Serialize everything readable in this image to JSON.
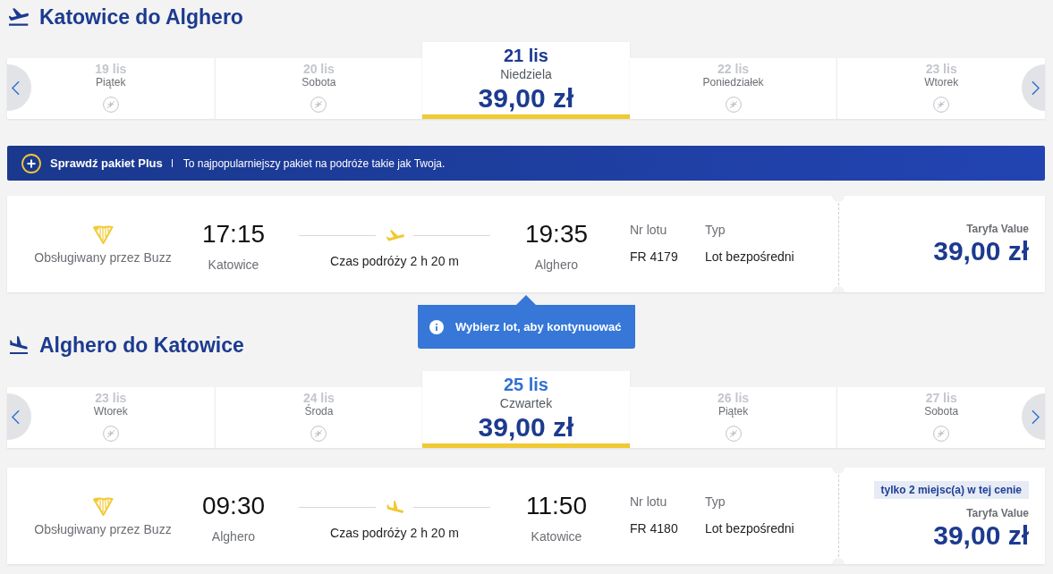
{
  "journeys": [
    {
      "kind": "departure",
      "title": "Katowice do Alghero",
      "dates": [
        {
          "date": "19 lis",
          "day": "Piątek",
          "selected": false,
          "hovered": false
        },
        {
          "date": "20 lis",
          "day": "Sobota",
          "selected": false,
          "hovered": false
        },
        {
          "date": "21 lis",
          "day": "Niedziela",
          "price": "39,00 zł",
          "selected": true,
          "hovered": false
        },
        {
          "date": "22 lis",
          "day": "Poniedziałek",
          "selected": false,
          "hovered": false
        },
        {
          "date": "23 lis",
          "day": "Wtorek",
          "selected": false,
          "hovered": false
        }
      ],
      "promo": {
        "title": "Sprawdź pakiet Plus",
        "text": "To najpopularniejszy pakiet na podróże takie jak Twoja."
      },
      "flight": {
        "operator": "Obsługiwany przez Buzz",
        "departure_time": "17:15",
        "departure_city": "Katowice",
        "duration": "Czas podróży 2 h 20 m",
        "arrival_time": "19:35",
        "arrival_city": "Alghero",
        "flight_number_label": "Nr lotu",
        "flight_number": "FR 4179",
        "type_label": "Typ",
        "type": "Lot bezpośredni",
        "fare": "Taryfa Value",
        "price": "39,00 zł"
      },
      "tooltip": {
        "text": "Wybierz lot, aby kontynuować"
      }
    },
    {
      "kind": "arrival",
      "title": "Alghero do Katowice",
      "dates": [
        {
          "date": "23 lis",
          "day": "Wtorek",
          "selected": false,
          "hovered": false
        },
        {
          "date": "24 lis",
          "day": "Środa",
          "selected": false,
          "hovered": false
        },
        {
          "date": "25 lis",
          "day": "Czwartek",
          "price": "39,00 zł",
          "selected": true,
          "hovered": true
        },
        {
          "date": "26 lis",
          "day": "Piątek",
          "selected": false,
          "hovered": false
        },
        {
          "date": "27 lis",
          "day": "Sobota",
          "selected": false,
          "hovered": false
        }
      ],
      "flight": {
        "operator": "Obsługiwany przez Buzz",
        "departure_time": "09:30",
        "departure_city": "Alghero",
        "duration": "Czas podróży 2 h 20 m",
        "arrival_time": "11:50",
        "arrival_city": "Katowice",
        "flight_number_label": "Nr lotu",
        "flight_number": "FR 4180",
        "type_label": "Typ",
        "type": "Lot bezpośredni",
        "badge": "tylko 2 miejsc(a) w tej cenie",
        "fare": "Taryfa Value",
        "price": "39,00 zł"
      }
    }
  ]
}
